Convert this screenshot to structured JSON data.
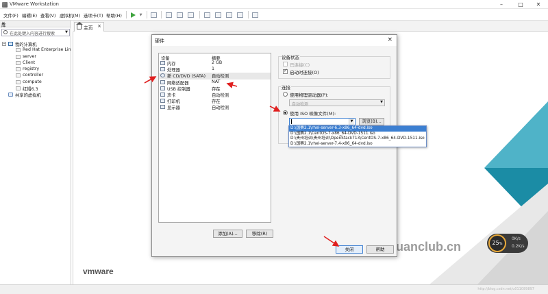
{
  "window": {
    "title": "VMware Workstation"
  },
  "menu": [
    "文件(F)",
    "编辑(E)",
    "查看(V)",
    "虚拟机(M)",
    "选项卡(T)",
    "帮助(H)"
  ],
  "library": {
    "header": "库",
    "search_placeholder": "在此处键入内容进行搜索",
    "root": "我的计算机",
    "vms": [
      "Red Hat Enterprise Lin",
      "server",
      "Client",
      "registry",
      "controller",
      "compute",
      "红帽6.3"
    ],
    "shared": "共享的虚拟机"
  },
  "tab": {
    "home": "主页"
  },
  "home": {
    "brand": "vmware",
    "gauge_value": "25",
    "gauge_unit": "%",
    "gauge_up": "0K/s",
    "gauge_down": "0.2K/s"
  },
  "watermark": "u.anquanclub.cn",
  "statusbar": "http://blog.csdn.net/u011089897",
  "dialog": {
    "title": "硬件",
    "col_device": "设备",
    "col_summary": "摘要",
    "devices": [
      {
        "name": "内存",
        "summary": "2 GB"
      },
      {
        "name": "处理器",
        "summary": "1"
      },
      {
        "name": "新 CD/DVD (SATA)",
        "summary": "自动检测"
      },
      {
        "name": "网络适配器",
        "summary": "NAT"
      },
      {
        "name": "USB 控制器",
        "summary": "存在"
      },
      {
        "name": "声卡",
        "summary": "自动检测"
      },
      {
        "name": "打印机",
        "summary": "存在"
      },
      {
        "name": "显示器",
        "summary": "自动检测"
      }
    ],
    "add_button": "添加(A)...",
    "remove_button": "移除(R)",
    "device_status": {
      "title": "设备状态",
      "connected": "已连接(C)",
      "connect_on_power": "启动时连接(O)"
    },
    "connection": {
      "title": "连接",
      "physical": "使用物理驱动器(P):",
      "physical_value": "自动检测",
      "iso": "使用 ISO 映像文件(M):",
      "browse": "浏览(B)..."
    },
    "iso_options": [
      "D:\\国赛2.1\\rhel-server-6.3-x86_64-dvd.iso",
      "D:\\国赛2.1\\CentOS-7-x86_64-DVD-1511.iso",
      "D:\\贵州培训\\贵州培训\\OpenStack713\\CentOS-7-x86_64-DVD-1511.iso",
      "D:\\国赛2.1\\rhel-server-7.4-x86_64-dvd.iso"
    ],
    "close_button": "关闭",
    "help_button": "帮助"
  },
  "colors": {
    "accent": "#3c7fd1",
    "annotation": "#e02020",
    "teal": "#0f8fa3"
  }
}
